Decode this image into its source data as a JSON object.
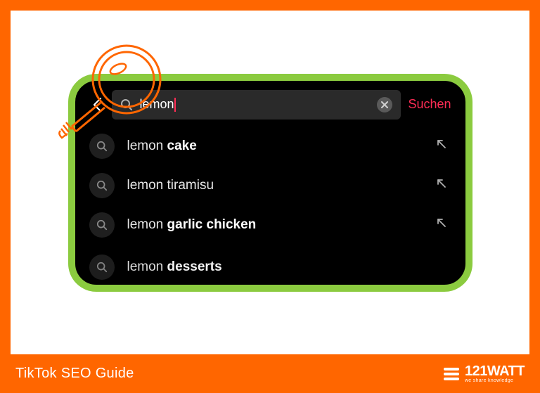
{
  "colors": {
    "accent_orange": "#ff6600",
    "accent_green": "#8bcb3f",
    "accent_pink": "#fe2c55"
  },
  "search": {
    "query": "lemon",
    "action_label": "Suchen"
  },
  "suggestions": [
    {
      "prefix": "lemon ",
      "bold": "cake"
    },
    {
      "prefix": "lemon ",
      "bold": "tiramisu",
      "plain_all": "lemon tiramisu"
    },
    {
      "prefix": "lemon ",
      "bold": "garlic chicken"
    },
    {
      "prefix": "lemon ",
      "bold": "desserts"
    }
  ],
  "footer": {
    "title": "TikTok SEO Guide",
    "brand": "121WATT",
    "tagline": "we share knowledge"
  }
}
